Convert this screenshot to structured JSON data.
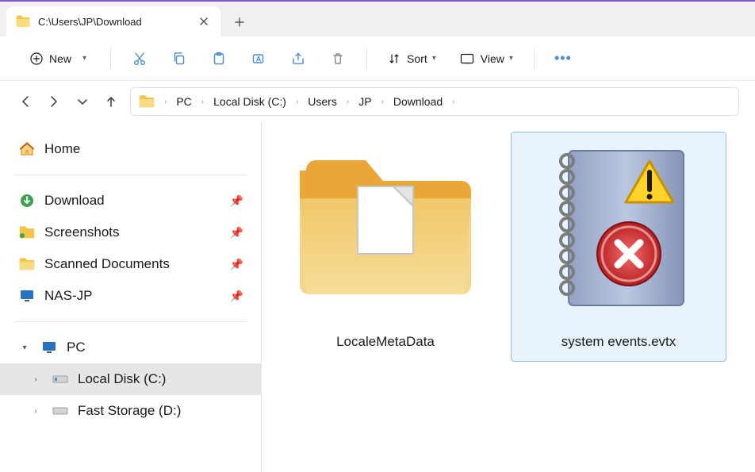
{
  "tab": {
    "title": "C:\\Users\\JP\\Download"
  },
  "toolbar": {
    "new": "New",
    "sort": "Sort",
    "view": "View"
  },
  "breadcrumbs": {
    "items": [
      "PC",
      "Local Disk (C:)",
      "Users",
      "JP",
      "Download"
    ]
  },
  "sidebar": {
    "home": "Home",
    "quick": {
      "download": "Download",
      "screenshots": "Screenshots",
      "scanned": "Scanned Documents",
      "nasjp": "NAS-JP"
    },
    "pc": "PC",
    "drives": {
      "c": "Local Disk (C:)",
      "d": "Fast Storage (D:)"
    }
  },
  "files": {
    "localeMeta": "LocaleMetaData",
    "systemEvents": "system events.evtx"
  }
}
